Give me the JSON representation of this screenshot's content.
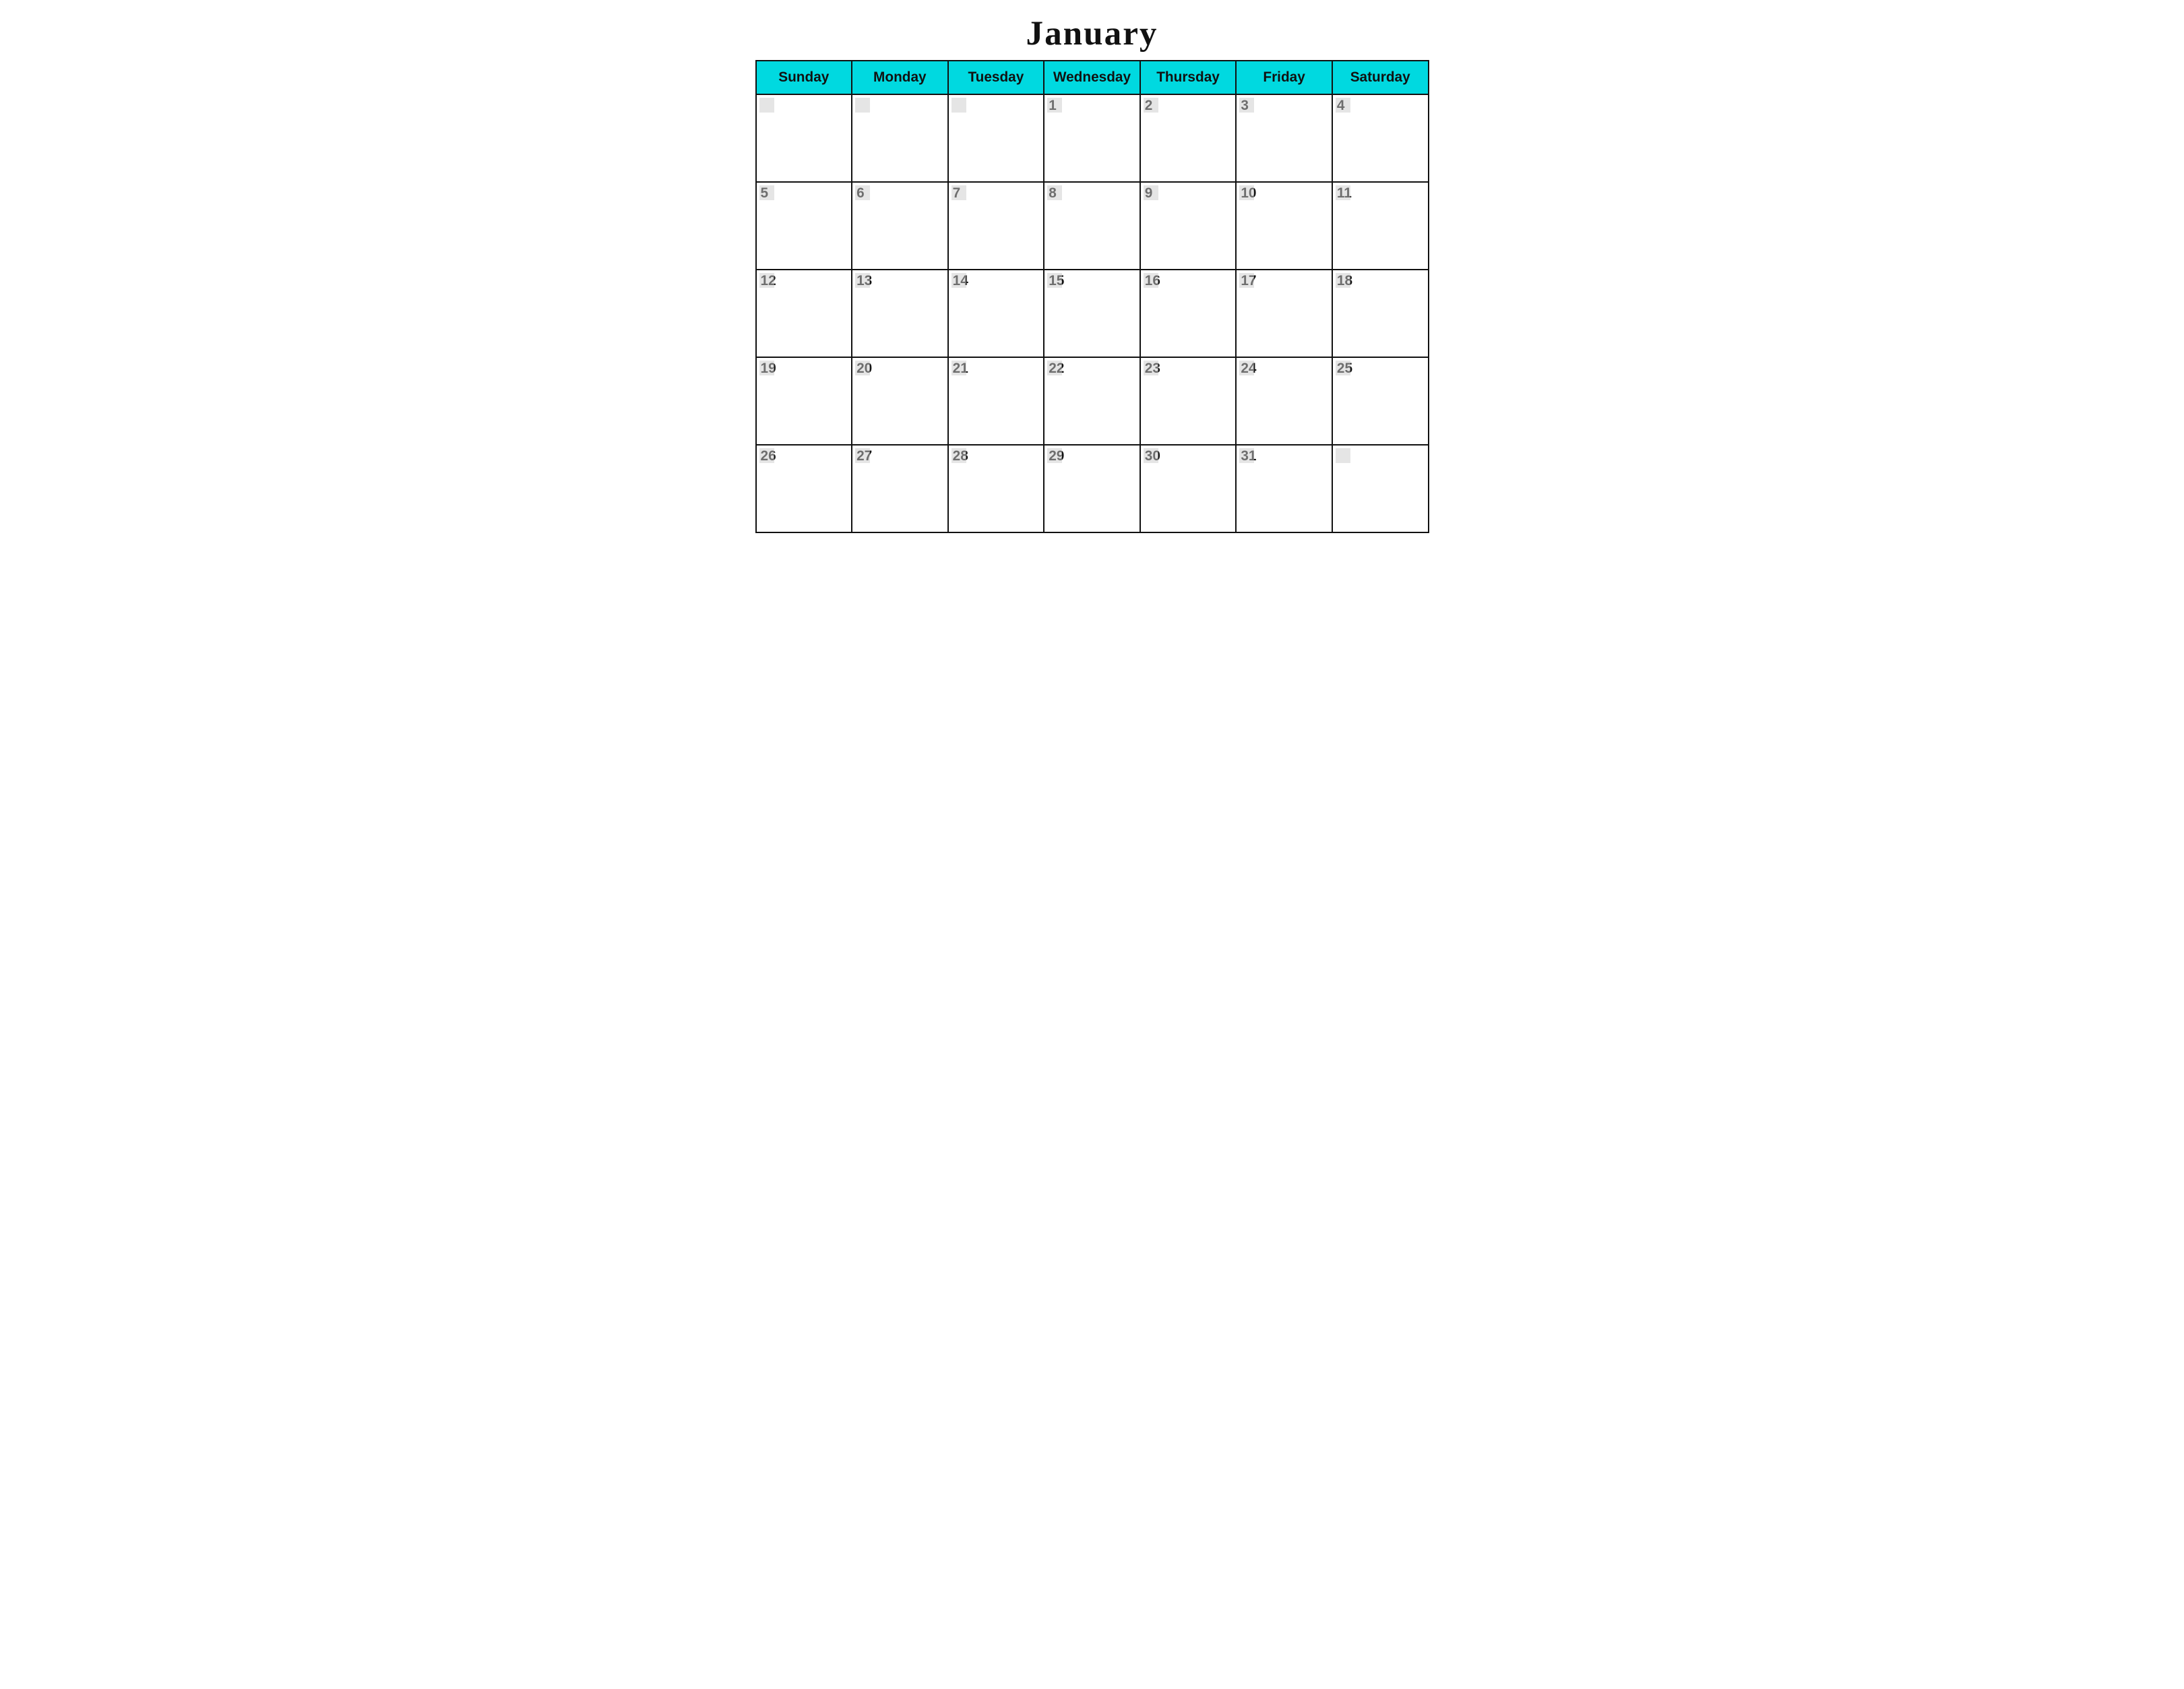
{
  "calendar": {
    "title": "January",
    "header": {
      "days": [
        "Sunday",
        "Monday",
        "Tuesday",
        "Wednesday",
        "Thursday",
        "Friday",
        "Saturday"
      ]
    },
    "weeks": [
      [
        {
          "day": "",
          "empty": true
        },
        {
          "day": "",
          "empty": true
        },
        {
          "day": "",
          "empty": true
        },
        {
          "day": "1",
          "empty": false
        },
        {
          "day": "2",
          "empty": false
        },
        {
          "day": "3",
          "empty": false
        },
        {
          "day": "4",
          "empty": false
        }
      ],
      [
        {
          "day": "5",
          "empty": false
        },
        {
          "day": "6",
          "empty": false
        },
        {
          "day": "7",
          "empty": false
        },
        {
          "day": "8",
          "empty": false
        },
        {
          "day": "9",
          "empty": false
        },
        {
          "day": "10",
          "empty": false
        },
        {
          "day": "11",
          "empty": false
        }
      ],
      [
        {
          "day": "12",
          "empty": false
        },
        {
          "day": "13",
          "empty": false
        },
        {
          "day": "14",
          "empty": false
        },
        {
          "day": "15",
          "empty": false
        },
        {
          "day": "16",
          "empty": false
        },
        {
          "day": "17",
          "empty": false
        },
        {
          "day": "18",
          "empty": false
        }
      ],
      [
        {
          "day": "19",
          "empty": false
        },
        {
          "day": "20",
          "empty": false
        },
        {
          "day": "21",
          "empty": false
        },
        {
          "day": "22",
          "empty": false
        },
        {
          "day": "23",
          "empty": false
        },
        {
          "day": "24",
          "empty": false
        },
        {
          "day": "25",
          "empty": false
        }
      ],
      [
        {
          "day": "26",
          "empty": false
        },
        {
          "day": "27",
          "empty": false
        },
        {
          "day": "28",
          "empty": false
        },
        {
          "day": "29",
          "empty": false
        },
        {
          "day": "30",
          "empty": false
        },
        {
          "day": "31",
          "empty": false
        },
        {
          "day": "",
          "empty": true
        }
      ]
    ]
  }
}
